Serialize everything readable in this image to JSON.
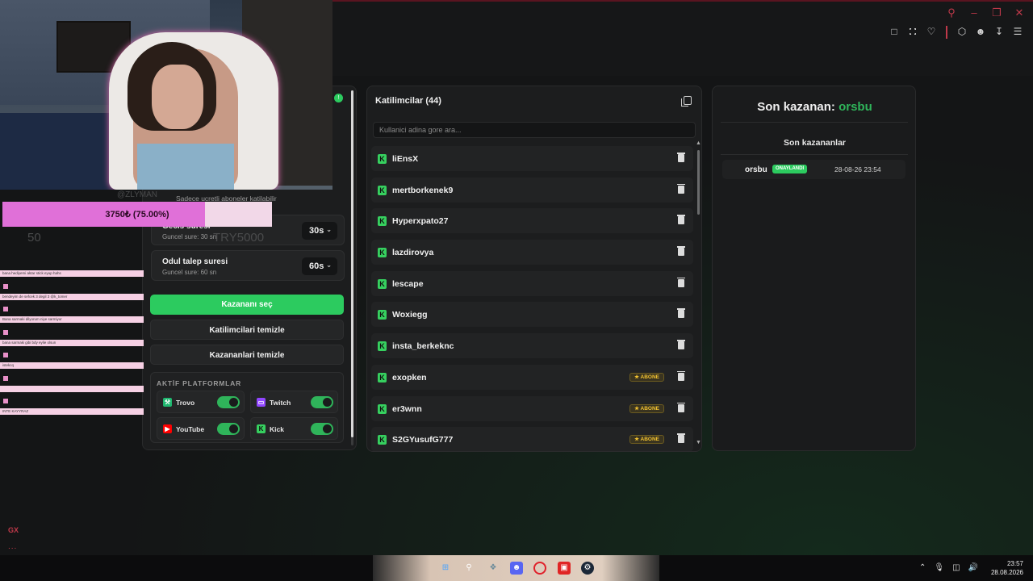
{
  "colors": {
    "accent_green": "#2ccb5f",
    "kick_green": "#36d05f",
    "browser_red": "#c0394a",
    "goal_pink": "#e070d8",
    "badge_gold": "#f2c230"
  },
  "browser": {
    "icons": [
      "search-icon",
      "minimize-icon",
      "restore-icon",
      "close-icon"
    ],
    "toolbar_icons": [
      "snapshot-icon",
      "shield-icon",
      "heart-icon",
      "box-icon",
      "account-icon",
      "download-icon",
      "menu-icon"
    ],
    "gx_label": "GX",
    "more_label": "..."
  },
  "overlay": {
    "goal_text": "3750₺ (75.00%)",
    "goal_fraction": 0.75,
    "ghost_left": "50",
    "ghost_right": "TRY5000",
    "ghost_top": "@ZLYMAN",
    "subscribers_note": "Sadece ucretli aboneler katilabilir",
    "chat_lines": [
      "bana hediyemi aktar stick eyup hahs",
      "bendeyim de sefcek 3 degil 3 @k_tomer",
      "Bana sarmaki dilyorum niye sarmiyor",
      "bana sarmaki gibi bdy eylie olsun",
      "istekcq",
      "",
      "INTE KAYYRAZ"
    ]
  },
  "settings": {
    "timer_label": "Gecis suresi",
    "timer_sub": "Guncel sure: 30 sn",
    "timer_value": "30s",
    "claim_label": "Odul talep suresi",
    "claim_sub": "Guncel sure: 60 sn",
    "claim_value": "60s",
    "pick_winner": "Kazananı seç",
    "clear_participants": "Katilimcilari temizle",
    "clear_winners": "Kazananlari temizle",
    "platforms_heading": "AKTİF PLATFORMLAR",
    "platforms": [
      {
        "name": "Trovo",
        "icon": "trovo-icon",
        "color": "#1fb870",
        "enabled": true
      },
      {
        "name": "Twitch",
        "icon": "twitch-icon",
        "color": "#9146ff",
        "enabled": true
      },
      {
        "name": "YouTube",
        "icon": "youtube-icon",
        "color": "#ff0000",
        "enabled": true
      },
      {
        "name": "Kick",
        "icon": "kick-icon",
        "color": "#36d05f",
        "enabled": true
      }
    ]
  },
  "participants": {
    "title": "Katilimcilar (44)",
    "search_placeholder": "Kullanici adina gore ara...",
    "subscriber_badge": "★ ABONE",
    "items": [
      {
        "name": "liEnsX",
        "sub": false
      },
      {
        "name": "mertborkenek9",
        "sub": false
      },
      {
        "name": "Hyperxpato27",
        "sub": false
      },
      {
        "name": "lazdirovya",
        "sub": false
      },
      {
        "name": "lescape",
        "sub": false
      },
      {
        "name": "Woxiegg",
        "sub": false
      },
      {
        "name": "insta_berkeknc",
        "sub": false
      },
      {
        "name": "exopken",
        "sub": true
      },
      {
        "name": "er3wnn",
        "sub": true
      },
      {
        "name": "S2GYusufG777",
        "sub": true
      }
    ]
  },
  "winner": {
    "title_prefix": "Son kazanan:",
    "name": "orsbu",
    "recent_heading": "Son kazananlar",
    "recent": [
      {
        "name": "orsbu",
        "status": "ONAYLANDI",
        "date": "28-08-26 23:54"
      }
    ]
  },
  "taskbar": {
    "apps": [
      "windows-icon",
      "search-icon",
      "widgets-icon",
      "discord-icon",
      "opera-gx-icon",
      "roblox-icon",
      "steam-icon"
    ],
    "tray": [
      "chevron-up-icon",
      "mic-icon",
      "network-icon",
      "volume-icon"
    ],
    "time": "23:57",
    "date": "28.08.2026"
  }
}
